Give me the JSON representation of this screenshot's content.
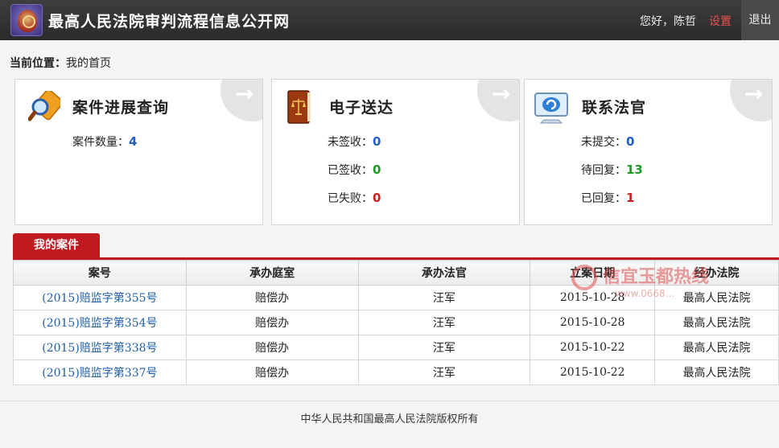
{
  "header": {
    "title": "最高人民法院审判流程信息公开网",
    "greeting": "您好，陈哲",
    "settings_label": "设置",
    "logout_label": "退出"
  },
  "breadcrumb": {
    "label": "当前位置：",
    "value": "我的首页"
  },
  "cards": {
    "case_query": {
      "title": "案件进展查询",
      "icon": "magnifier-icon",
      "rows": [
        {
          "label": "案件数量：",
          "value": "4",
          "color": "#1f5fc7"
        }
      ]
    },
    "e_delivery": {
      "title": "电子送达",
      "icon": "law-book-icon",
      "rows": [
        {
          "label": "未签收：",
          "value": "0",
          "color": "#1f5fc7"
        },
        {
          "label": "已签收：",
          "value": "0",
          "color": "#1a9a22"
        },
        {
          "label": "已失败：",
          "value": "0",
          "color": "#cc1f1f"
        }
      ]
    },
    "contact_judge": {
      "title": "联系法官",
      "icon": "monitor-icon",
      "rows": [
        {
          "label": "未提交：",
          "value": "0",
          "color": "#1f5fc7"
        },
        {
          "label": "待回复：",
          "value": "13",
          "color": "#1a9a22"
        },
        {
          "label": "已回复：",
          "value": "1",
          "color": "#cc1f1f"
        }
      ]
    }
  },
  "tab": {
    "label": "我的案件"
  },
  "table": {
    "headers": [
      "案号",
      "承办庭室",
      "承办法官",
      "立案日期",
      "经办法院"
    ],
    "rows": [
      [
        "(2015)赔监字第355号",
        "赔偿办",
        "汪军",
        "2015-10-28",
        "最高人民法院"
      ],
      [
        "(2015)赔监字第354号",
        "赔偿办",
        "汪军",
        "2015-10-28",
        "最高人民法院"
      ],
      [
        "(2015)赔监字第338号",
        "赔偿办",
        "汪军",
        "2015-10-22",
        "最高人民法院"
      ],
      [
        "(2015)赔监字第337号",
        "赔偿办",
        "汪军",
        "2015-10-22",
        "最高人民法院"
      ]
    ]
  },
  "watermark": {
    "text": "信宜玉都热线",
    "sub": "www.0668..."
  },
  "footer": {
    "text": "中华人民共和国最高人民法院版权所有"
  },
  "colors": {
    "accent_red": "#c0191f",
    "header_bg": "#333333",
    "link_blue": "#1f5fa8"
  }
}
